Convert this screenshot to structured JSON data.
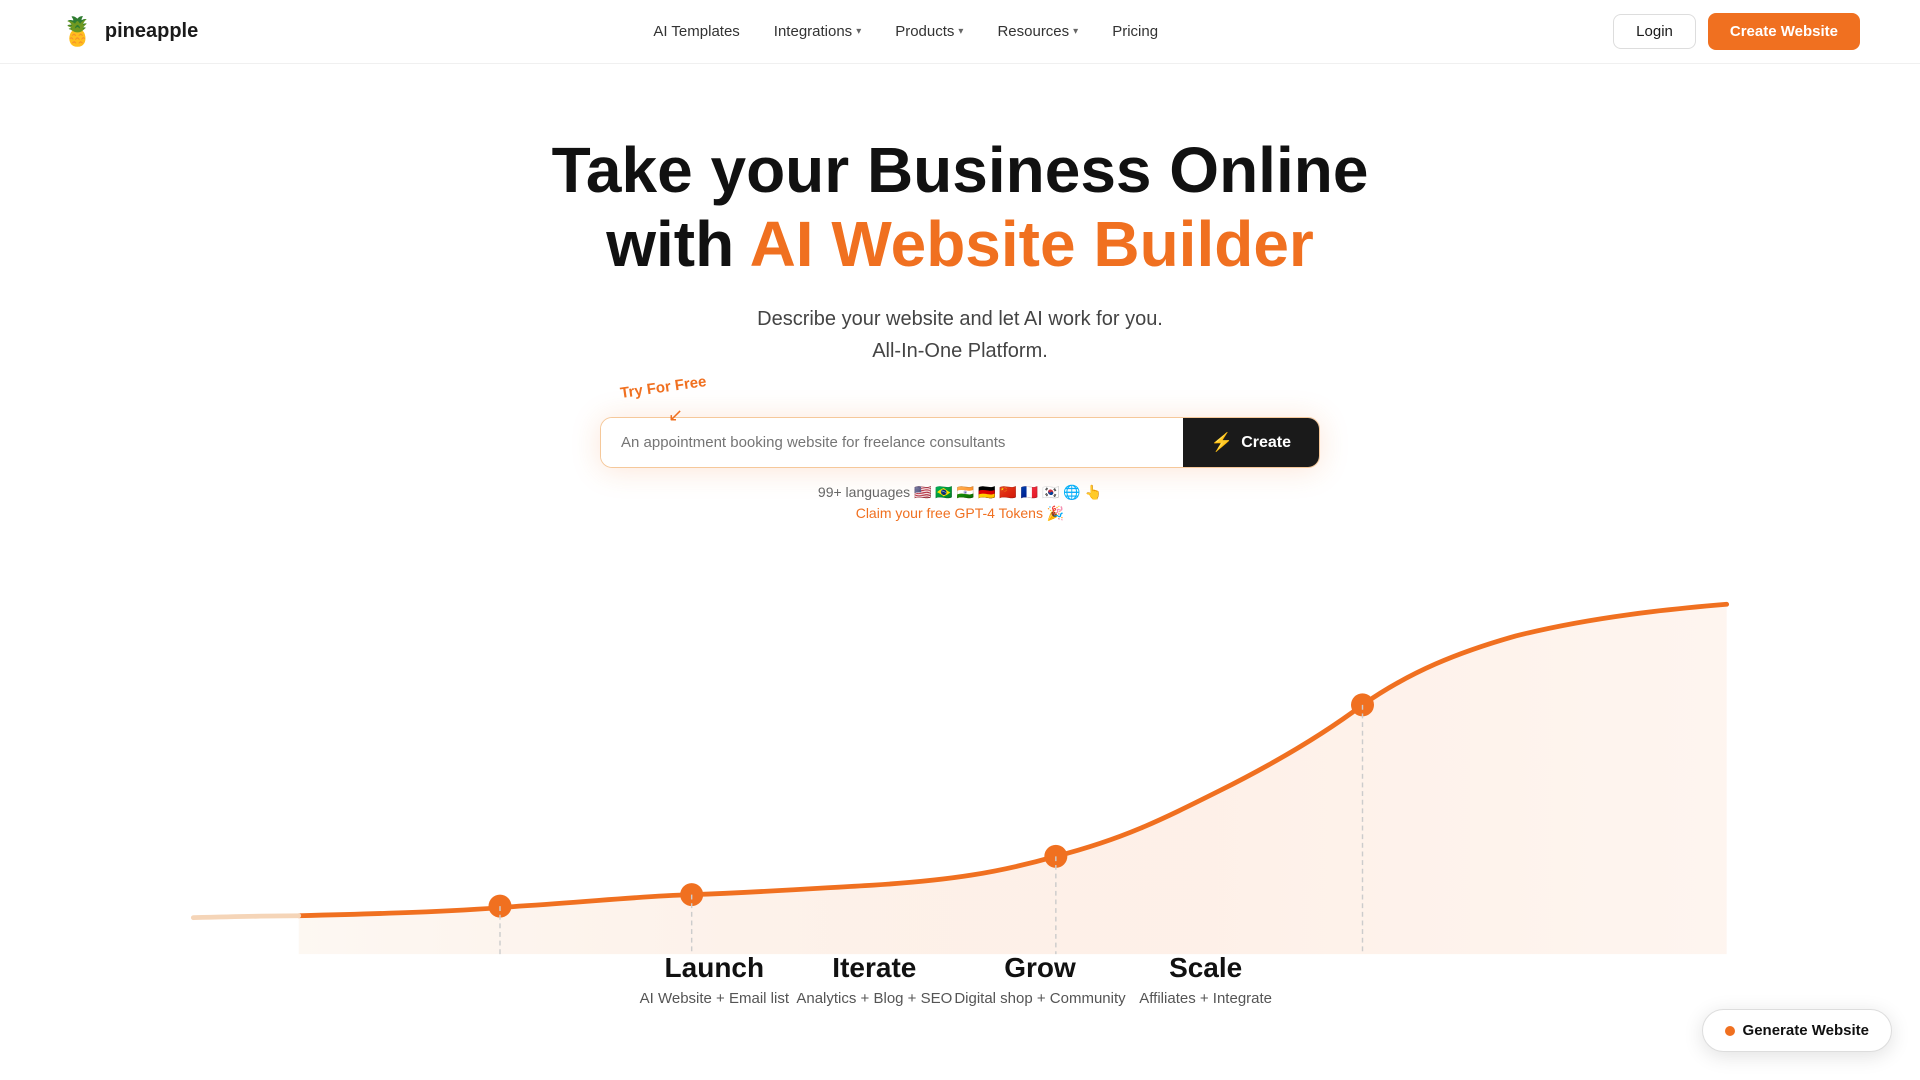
{
  "brand": {
    "name": "pineapple",
    "logo_icon": "🍍"
  },
  "nav": {
    "links": [
      {
        "label": "AI Templates",
        "has_dropdown": false
      },
      {
        "label": "Integrations",
        "has_dropdown": true
      },
      {
        "label": "Products",
        "has_dropdown": true
      },
      {
        "label": "Resources",
        "has_dropdown": true
      },
      {
        "label": "Pricing",
        "has_dropdown": false
      }
    ],
    "login_label": "Login",
    "create_website_label": "Create Website"
  },
  "hero": {
    "title_line1": "Take your Business Online",
    "title_line2_prefix": "with ",
    "title_line2_highlight": "AI Website Builder",
    "subtitle_line1": "Describe your website and let AI work for you.",
    "subtitle_line2": "All-In-One Platform.",
    "try_free_label": "Try For Free",
    "search_placeholder": "An appointment booking website for freelance consultants",
    "create_button_label": "Create",
    "language_line": "99+ languages 🇺🇸 🇧🇷 🇮🇳 🇩🇪 🇨🇳 🇫🇷 🇰🇷 🌐 👆",
    "claim_gpt_label": "Claim your free GPT-4 Tokens 🎉"
  },
  "stages": [
    {
      "name": "Launch",
      "desc": "AI Website + Email list"
    },
    {
      "name": "Iterate",
      "desc": "Analytics + Blog + SEO"
    },
    {
      "name": "Grow",
      "desc": "Digital shop + Community"
    },
    {
      "name": "Scale",
      "desc": "Affiliates + Integrate"
    }
  ],
  "floating_button": {
    "label": "Generate Website"
  },
  "colors": {
    "orange": "#f07020",
    "dark": "#1a1a1a",
    "curve_light": "#f5d5b8"
  }
}
